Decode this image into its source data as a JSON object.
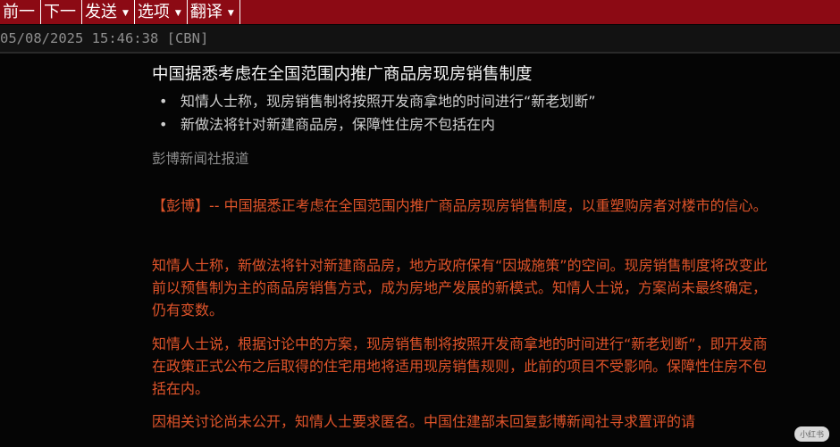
{
  "menubar": {
    "items": [
      {
        "label": "前一",
        "has_dropdown": false
      },
      {
        "label": "下一",
        "has_dropdown": false
      },
      {
        "label": "发送",
        "has_dropdown": true
      },
      {
        "label": "选项",
        "has_dropdown": true
      },
      {
        "label": "翻译",
        "has_dropdown": true
      }
    ],
    "caret_icon": "▼"
  },
  "meta": {
    "timestamp_source": "05/08/2025 15:46:38 [CBN]"
  },
  "article": {
    "headline": "中国据悉考虑在全国范围内推广商品房现房销售制度",
    "bullets": [
      "知情人士称，现房销售制将按照开发商拿地的时间进行“新老划断”",
      "新做法将针对新建商品房，保障性住房不包括在内"
    ],
    "source": "彭博新闻社报道",
    "paragraphs": [
      "【彭博】-- 中国据悉正考虑在全国范围内推广商品房现房销售制度，以重塑购房者对楼市的信心。",
      "知情人士称，新做法将针对新建商品房，地方政府保有“因城施策”的空间。现房销售制度将改变此前以预售制为主的商品房销售方式，成为房地产发展的新模式。知情人士说，方案尚未最终确定，仍有变数。",
      "知情人士说，根据讨论中的方案，现房销售制将按照开发商拿地的时间进行“新老划断”，即开发商在政策正式公布之后取得的住宅用地将适用现房销售规则，此前的项目不受影响。保障性住房不包括在内。",
      "因相关讨论尚未公开，知情人士要求匿名。中国住建部未回复彭博新闻社寻求置评的请"
    ]
  },
  "watermark": "小红书",
  "colors": {
    "menubar_bg": "#8c0a14",
    "body_text": "#e0542a",
    "headline": "#f2f2f2",
    "background": "#050505"
  }
}
